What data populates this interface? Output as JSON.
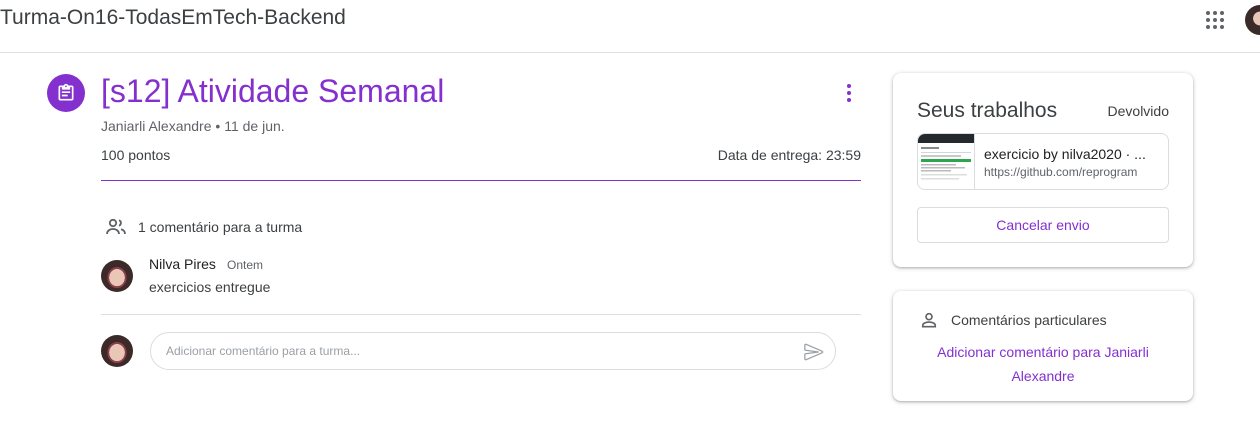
{
  "header": {
    "course_title": "Turma-On16-TodasEmTech-Backend",
    "apps_icon": "google-apps-grid-icon",
    "account_icon": "account-avatar"
  },
  "assignment": {
    "icon": "assignment-clipboard-icon",
    "title": "[s12] Atividade Semanal",
    "author": "Janiarli Alexandre",
    "date": "11 de jun.",
    "meta_separator": "•",
    "points": "100 pontos",
    "due": "Data de entrega: 23:59",
    "accent_color": "#8430ce"
  },
  "class_comments": {
    "icon": "people-icon",
    "count_label": "1 comentário para a turma",
    "comments": [
      {
        "author": "Nilva Pires",
        "time": "Ontem",
        "text": "exercicios entregue"
      }
    ],
    "input_placeholder": "Adicionar comentário para a turma...",
    "send_icon": "send-icon"
  },
  "your_work": {
    "title": "Seus trabalhos",
    "status": "Devolvido",
    "attachment": {
      "title": "exercicio by nilva2020 · ...",
      "url": "https://github.com/reprogram"
    },
    "unsubmit_label": "Cancelar envio"
  },
  "private_comments": {
    "icon": "person-icon",
    "title": "Comentários particulares",
    "add_link": "Adicionar comentário para Janiarli Alexandre"
  }
}
